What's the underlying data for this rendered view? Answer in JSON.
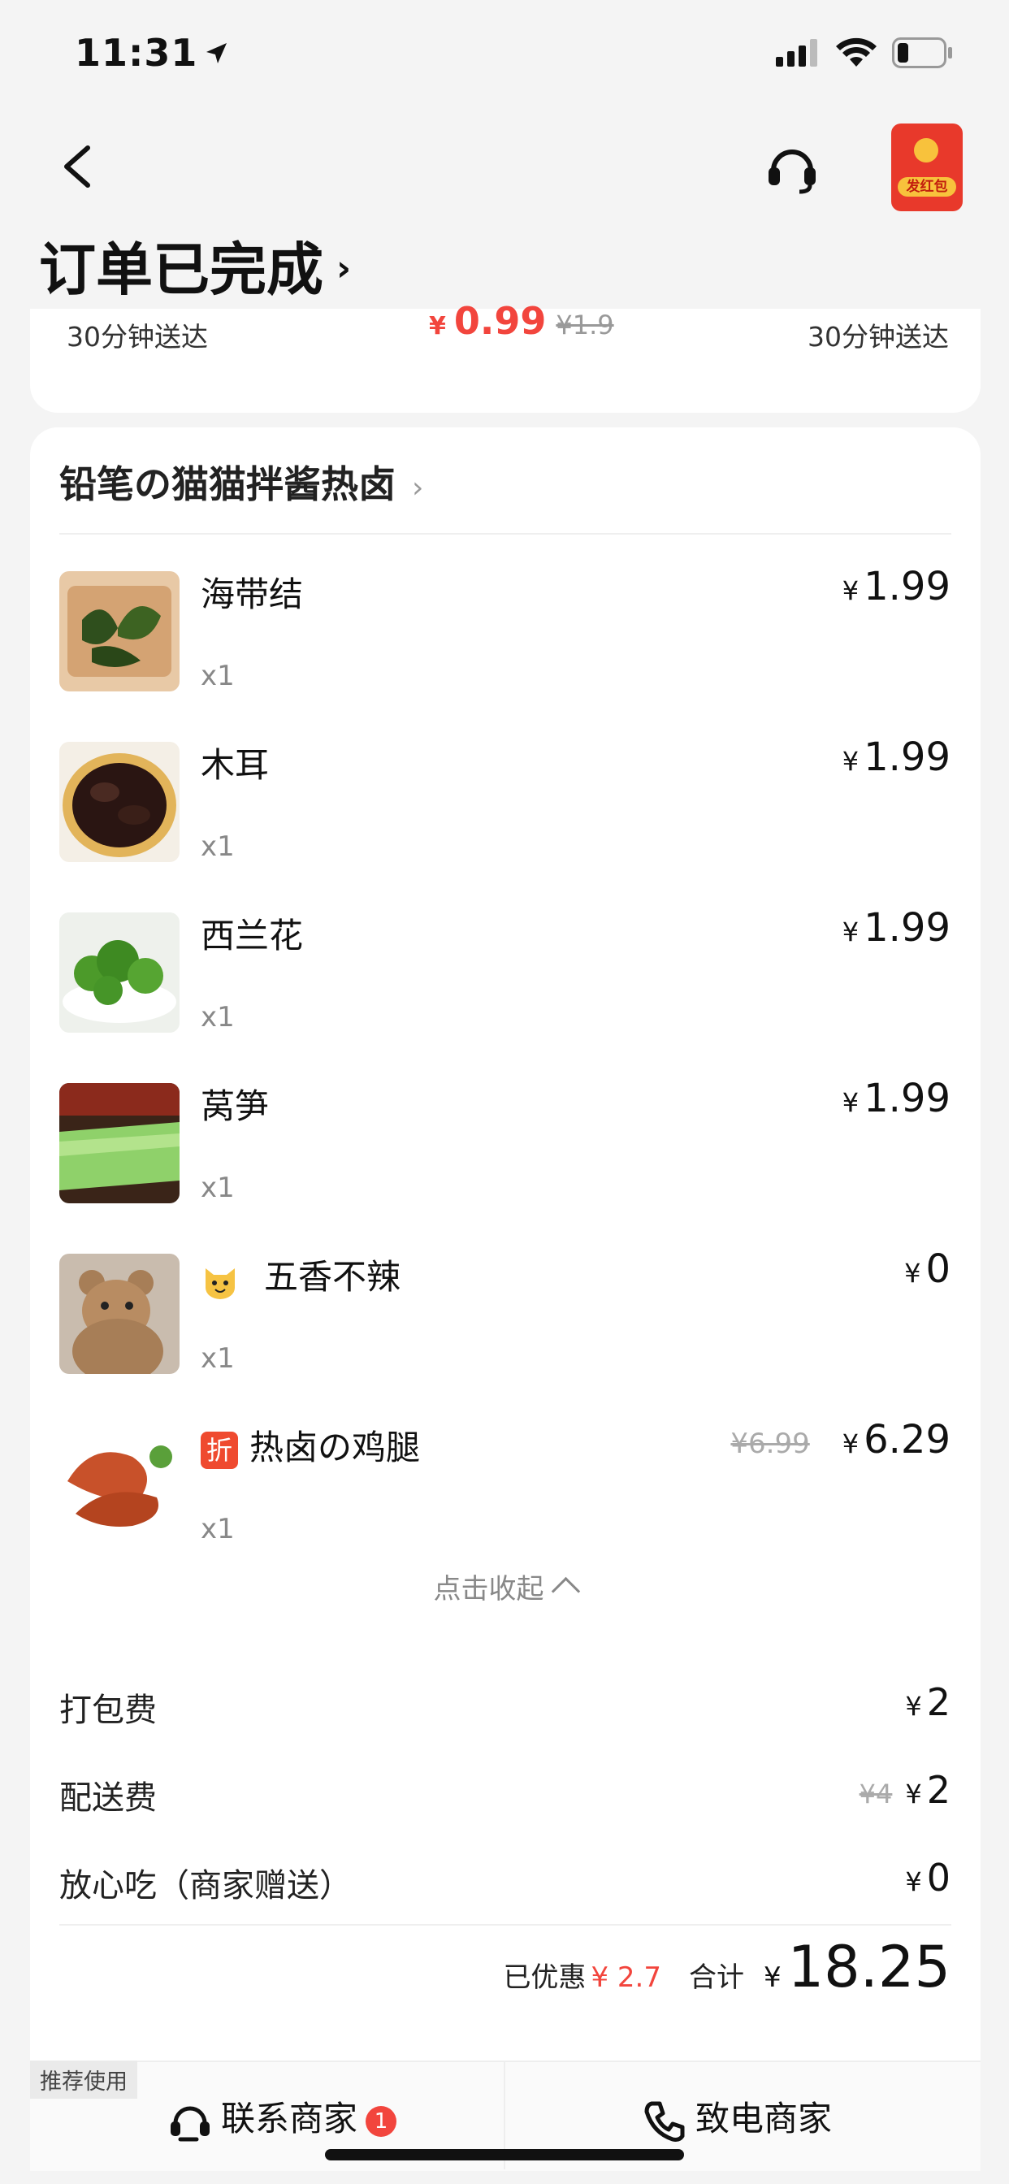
{
  "status_bar": {
    "time": "11:31"
  },
  "header": {
    "title": "订单已完成",
    "red_packet_label": "发红包"
  },
  "top_card": {
    "delivery_left": "30分钟送达",
    "delivery_right": "30分钟送达",
    "promo_yen": "¥",
    "promo_price": "0.99",
    "promo_old_price": "¥1.9"
  },
  "shop": {
    "name": "铅笔の猫猫拌酱热卤"
  },
  "items": [
    {
      "name": "海带结",
      "qty": "x1",
      "yen": "¥",
      "price": "1.99"
    },
    {
      "name": "木耳",
      "qty": "x1",
      "yen": "¥",
      "price": "1.99"
    },
    {
      "name": "西兰花",
      "qty": "x1",
      "yen": "¥",
      "price": "1.99"
    },
    {
      "name": "莴笋",
      "qty": "x1",
      "yen": "¥",
      "price": "1.99"
    },
    {
      "name": "五香不辣",
      "qty": "x1",
      "yen": "¥",
      "price": "0"
    },
    {
      "name": "热卤の鸡腿",
      "qty": "x1",
      "yen": "¥",
      "price": "6.29",
      "old_price": "¥6.99",
      "tag": "折"
    }
  ],
  "collapse_label": "点击收起",
  "fees": [
    {
      "label": "打包费",
      "yen": "¥",
      "value": "2"
    },
    {
      "label": "配送费",
      "old": "¥4",
      "yen": "¥",
      "value": "2"
    },
    {
      "label": "放心吃（商家赠送）",
      "yen": "¥",
      "value": "0"
    }
  ],
  "summary": {
    "discount_label": "已优惠",
    "discount_value": "¥ 2.7",
    "total_label": "合计",
    "yen": "¥",
    "total_value": "18.25"
  },
  "bottom_bar": {
    "recommend_tag": "推荐使用",
    "contact_label": "联系商家",
    "contact_badge": "1",
    "call_label": "致电商家"
  },
  "colors": {
    "accent_red": "#f2453d",
    "tag_orange": "#ef4a2f",
    "background": "#f4f4f4"
  },
  "icons": {
    "back": "chevron-left-icon",
    "support": "headset-icon",
    "red_packet": "red-packet-icon",
    "chat": "chat-service-icon",
    "phone": "phone-icon"
  }
}
